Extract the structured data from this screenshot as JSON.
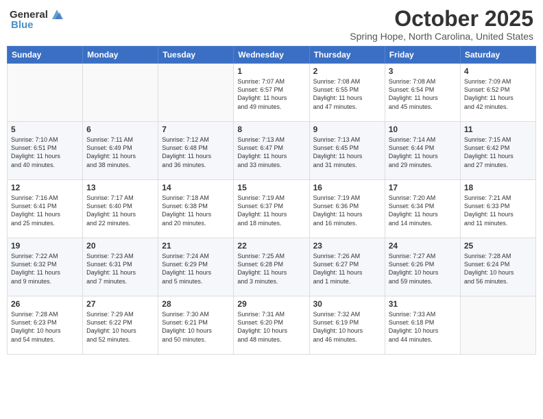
{
  "header": {
    "logo_general": "General",
    "logo_blue": "Blue",
    "month": "October 2025",
    "location": "Spring Hope, North Carolina, United States"
  },
  "days_of_week": [
    "Sunday",
    "Monday",
    "Tuesday",
    "Wednesday",
    "Thursday",
    "Friday",
    "Saturday"
  ],
  "weeks": [
    [
      {
        "day": "",
        "content": ""
      },
      {
        "day": "",
        "content": ""
      },
      {
        "day": "",
        "content": ""
      },
      {
        "day": "1",
        "content": "Sunrise: 7:07 AM\nSunset: 6:57 PM\nDaylight: 11 hours\nand 49 minutes."
      },
      {
        "day": "2",
        "content": "Sunrise: 7:08 AM\nSunset: 6:55 PM\nDaylight: 11 hours\nand 47 minutes."
      },
      {
        "day": "3",
        "content": "Sunrise: 7:08 AM\nSunset: 6:54 PM\nDaylight: 11 hours\nand 45 minutes."
      },
      {
        "day": "4",
        "content": "Sunrise: 7:09 AM\nSunset: 6:52 PM\nDaylight: 11 hours\nand 42 minutes."
      }
    ],
    [
      {
        "day": "5",
        "content": "Sunrise: 7:10 AM\nSunset: 6:51 PM\nDaylight: 11 hours\nand 40 minutes."
      },
      {
        "day": "6",
        "content": "Sunrise: 7:11 AM\nSunset: 6:49 PM\nDaylight: 11 hours\nand 38 minutes."
      },
      {
        "day": "7",
        "content": "Sunrise: 7:12 AM\nSunset: 6:48 PM\nDaylight: 11 hours\nand 36 minutes."
      },
      {
        "day": "8",
        "content": "Sunrise: 7:13 AM\nSunset: 6:47 PM\nDaylight: 11 hours\nand 33 minutes."
      },
      {
        "day": "9",
        "content": "Sunrise: 7:13 AM\nSunset: 6:45 PM\nDaylight: 11 hours\nand 31 minutes."
      },
      {
        "day": "10",
        "content": "Sunrise: 7:14 AM\nSunset: 6:44 PM\nDaylight: 11 hours\nand 29 minutes."
      },
      {
        "day": "11",
        "content": "Sunrise: 7:15 AM\nSunset: 6:42 PM\nDaylight: 11 hours\nand 27 minutes."
      }
    ],
    [
      {
        "day": "12",
        "content": "Sunrise: 7:16 AM\nSunset: 6:41 PM\nDaylight: 11 hours\nand 25 minutes."
      },
      {
        "day": "13",
        "content": "Sunrise: 7:17 AM\nSunset: 6:40 PM\nDaylight: 11 hours\nand 22 minutes."
      },
      {
        "day": "14",
        "content": "Sunrise: 7:18 AM\nSunset: 6:38 PM\nDaylight: 11 hours\nand 20 minutes."
      },
      {
        "day": "15",
        "content": "Sunrise: 7:19 AM\nSunset: 6:37 PM\nDaylight: 11 hours\nand 18 minutes."
      },
      {
        "day": "16",
        "content": "Sunrise: 7:19 AM\nSunset: 6:36 PM\nDaylight: 11 hours\nand 16 minutes."
      },
      {
        "day": "17",
        "content": "Sunrise: 7:20 AM\nSunset: 6:34 PM\nDaylight: 11 hours\nand 14 minutes."
      },
      {
        "day": "18",
        "content": "Sunrise: 7:21 AM\nSunset: 6:33 PM\nDaylight: 11 hours\nand 11 minutes."
      }
    ],
    [
      {
        "day": "19",
        "content": "Sunrise: 7:22 AM\nSunset: 6:32 PM\nDaylight: 11 hours\nand 9 minutes."
      },
      {
        "day": "20",
        "content": "Sunrise: 7:23 AM\nSunset: 6:31 PM\nDaylight: 11 hours\nand 7 minutes."
      },
      {
        "day": "21",
        "content": "Sunrise: 7:24 AM\nSunset: 6:29 PM\nDaylight: 11 hours\nand 5 minutes."
      },
      {
        "day": "22",
        "content": "Sunrise: 7:25 AM\nSunset: 6:28 PM\nDaylight: 11 hours\nand 3 minutes."
      },
      {
        "day": "23",
        "content": "Sunrise: 7:26 AM\nSunset: 6:27 PM\nDaylight: 11 hours\nand 1 minute."
      },
      {
        "day": "24",
        "content": "Sunrise: 7:27 AM\nSunset: 6:26 PM\nDaylight: 10 hours\nand 59 minutes."
      },
      {
        "day": "25",
        "content": "Sunrise: 7:28 AM\nSunset: 6:24 PM\nDaylight: 10 hours\nand 56 minutes."
      }
    ],
    [
      {
        "day": "26",
        "content": "Sunrise: 7:28 AM\nSunset: 6:23 PM\nDaylight: 10 hours\nand 54 minutes."
      },
      {
        "day": "27",
        "content": "Sunrise: 7:29 AM\nSunset: 6:22 PM\nDaylight: 10 hours\nand 52 minutes."
      },
      {
        "day": "28",
        "content": "Sunrise: 7:30 AM\nSunset: 6:21 PM\nDaylight: 10 hours\nand 50 minutes."
      },
      {
        "day": "29",
        "content": "Sunrise: 7:31 AM\nSunset: 6:20 PM\nDaylight: 10 hours\nand 48 minutes."
      },
      {
        "day": "30",
        "content": "Sunrise: 7:32 AM\nSunset: 6:19 PM\nDaylight: 10 hours\nand 46 minutes."
      },
      {
        "day": "31",
        "content": "Sunrise: 7:33 AM\nSunset: 6:18 PM\nDaylight: 10 hours\nand 44 minutes."
      },
      {
        "day": "",
        "content": ""
      }
    ]
  ]
}
